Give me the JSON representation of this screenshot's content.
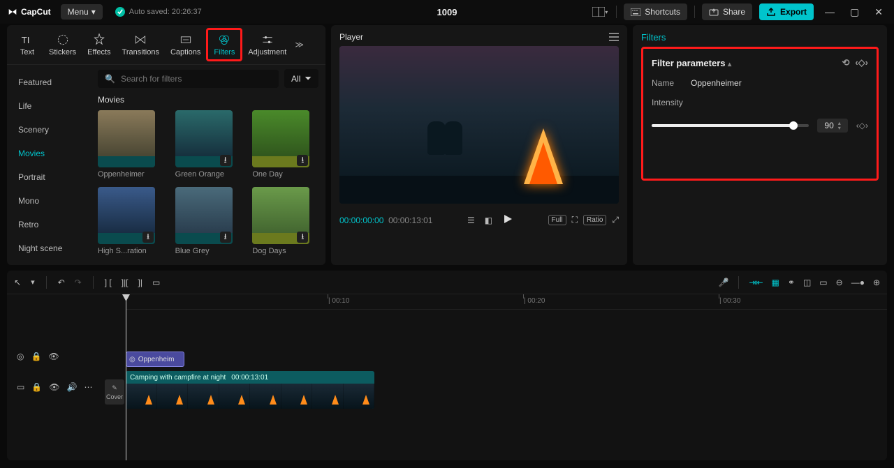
{
  "app": {
    "name": "CapCut",
    "menu": "Menu",
    "saved": "Auto saved: 20:26:37",
    "title": "1009"
  },
  "top": {
    "shortcuts": "Shortcuts",
    "share": "Share",
    "export": "Export"
  },
  "tabs": {
    "text": "Text",
    "stickers": "Stickers",
    "effects": "Effects",
    "transitions": "Transitions",
    "captions": "Captions",
    "filters": "Filters",
    "adjustment": "Adjustment"
  },
  "cats": {
    "featured": "Featured",
    "life": "Life",
    "scenery": "Scenery",
    "movies": "Movies",
    "portrait": "Portrait",
    "mono": "Mono",
    "retro": "Retro",
    "night": "Night scene"
  },
  "search": {
    "placeholder": "Search for filters",
    "all": "All"
  },
  "section": {
    "movies": "Movies"
  },
  "cards": {
    "oppenheimer": "Oppenheimer",
    "greenorange": "Green Orange",
    "oneday": "One Day",
    "highsat": "High S...ration",
    "bluegrey": "Blue Grey",
    "dogdays": "Dog Days"
  },
  "player": {
    "title": "Player",
    "cur": "00:00:00:00",
    "dur": "00:00:13:01",
    "full": "Full",
    "ratio": "Ratio"
  },
  "right": {
    "title": "Filters",
    "params": "Filter parameters",
    "nameLbl": "Name",
    "nameVal": "Oppenheimer",
    "intensityLbl": "Intensity",
    "intensityVal": "90"
  },
  "ruler": {
    "t10": "| 00:10",
    "t20": "| 00:20",
    "t30": "| 00:30"
  },
  "timeline": {
    "filterClip": "Oppenheim",
    "videoName": "Camping with campfire at night",
    "videoDur": "00:00:13:01",
    "cover": "Cover"
  }
}
